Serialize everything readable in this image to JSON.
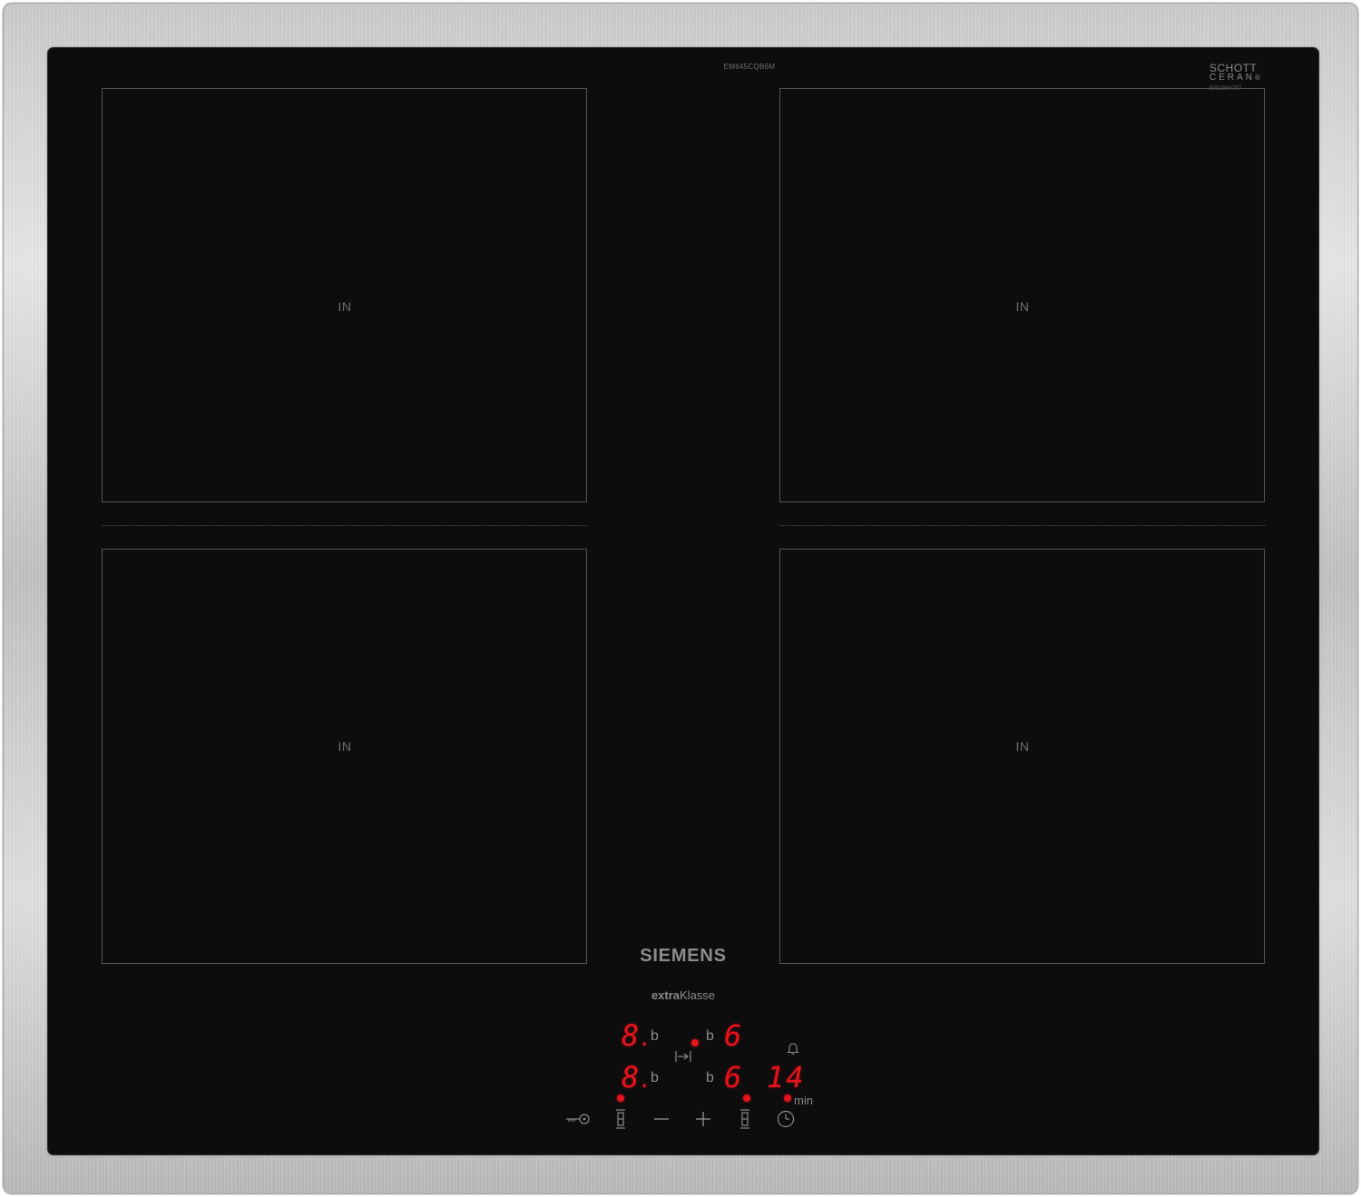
{
  "hob": {
    "model_code": "EM645CQB6M",
    "glass_brand": {
      "line1": "SCHOTT",
      "line2": "CERAN",
      "registered": "®",
      "serial": "9001804797"
    },
    "zones": [
      {
        "label": "IN"
      },
      {
        "label": "IN"
      },
      {
        "label": "IN"
      },
      {
        "label": "IN"
      }
    ],
    "brand": "SIEMENS",
    "subbrand": {
      "prefix": "extra",
      "suffix": "Klasse"
    }
  },
  "control_panel": {
    "left_rear_level": "8",
    "left_front_level": "8",
    "right_rear_level": "6",
    "right_front_level": "6",
    "booster_letter": "b",
    "timer_value": "14",
    "timer_unit": "min",
    "icons": {
      "lock": "key-lock-icon",
      "zone_select_left": "cooking-zone-select-icon",
      "minus": "minus-icon",
      "plus": "plus-icon",
      "zone_select_right": "cooking-zone-select-icon",
      "timer": "clock-icon",
      "alarm": "bell-icon",
      "transfer": "move-function-icon"
    },
    "led_color": "#e8131a"
  },
  "colors": {
    "glass": "#0d0d0e",
    "zone_outline": "#555557",
    "frame": "#c9cacc",
    "display_red": "#e8131a"
  }
}
